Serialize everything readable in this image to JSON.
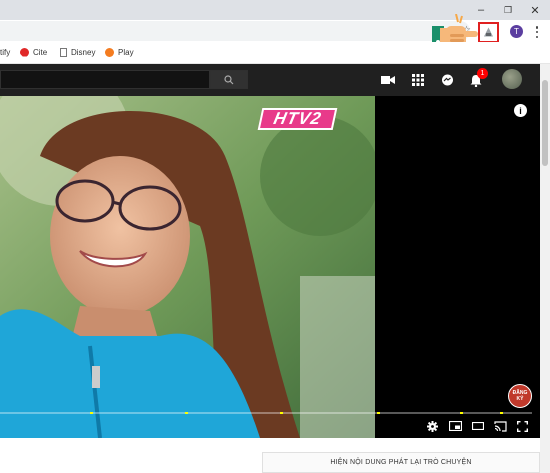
{
  "browser": {
    "window_controls": {
      "minimize": "–",
      "maximize": "❐",
      "close": "✕"
    },
    "profile_initial": "T",
    "omnibox_partial_text": "☆",
    "bookmarks": [
      {
        "label": "tify",
        "icon": "bookmark-icon"
      },
      {
        "label": "Cite",
        "icon": "cite-icon"
      },
      {
        "label": "Disney",
        "icon": "page-icon"
      },
      {
        "label": "Play",
        "icon": "play-icon"
      }
    ],
    "extension_icon": "extension-icon"
  },
  "youtube": {
    "notification_count": "1",
    "channel_logo": "HTV2",
    "subscribe_watermark": "ĐĂNG KÝ",
    "chat_replay_button": "HIỆN NỘI DUNG PHÁT LẠI TRÒ CHUYỆN",
    "progress": 0.0,
    "colors": {
      "header": "#202020",
      "accent": "#ff0000",
      "marker": "#ffff00"
    }
  }
}
